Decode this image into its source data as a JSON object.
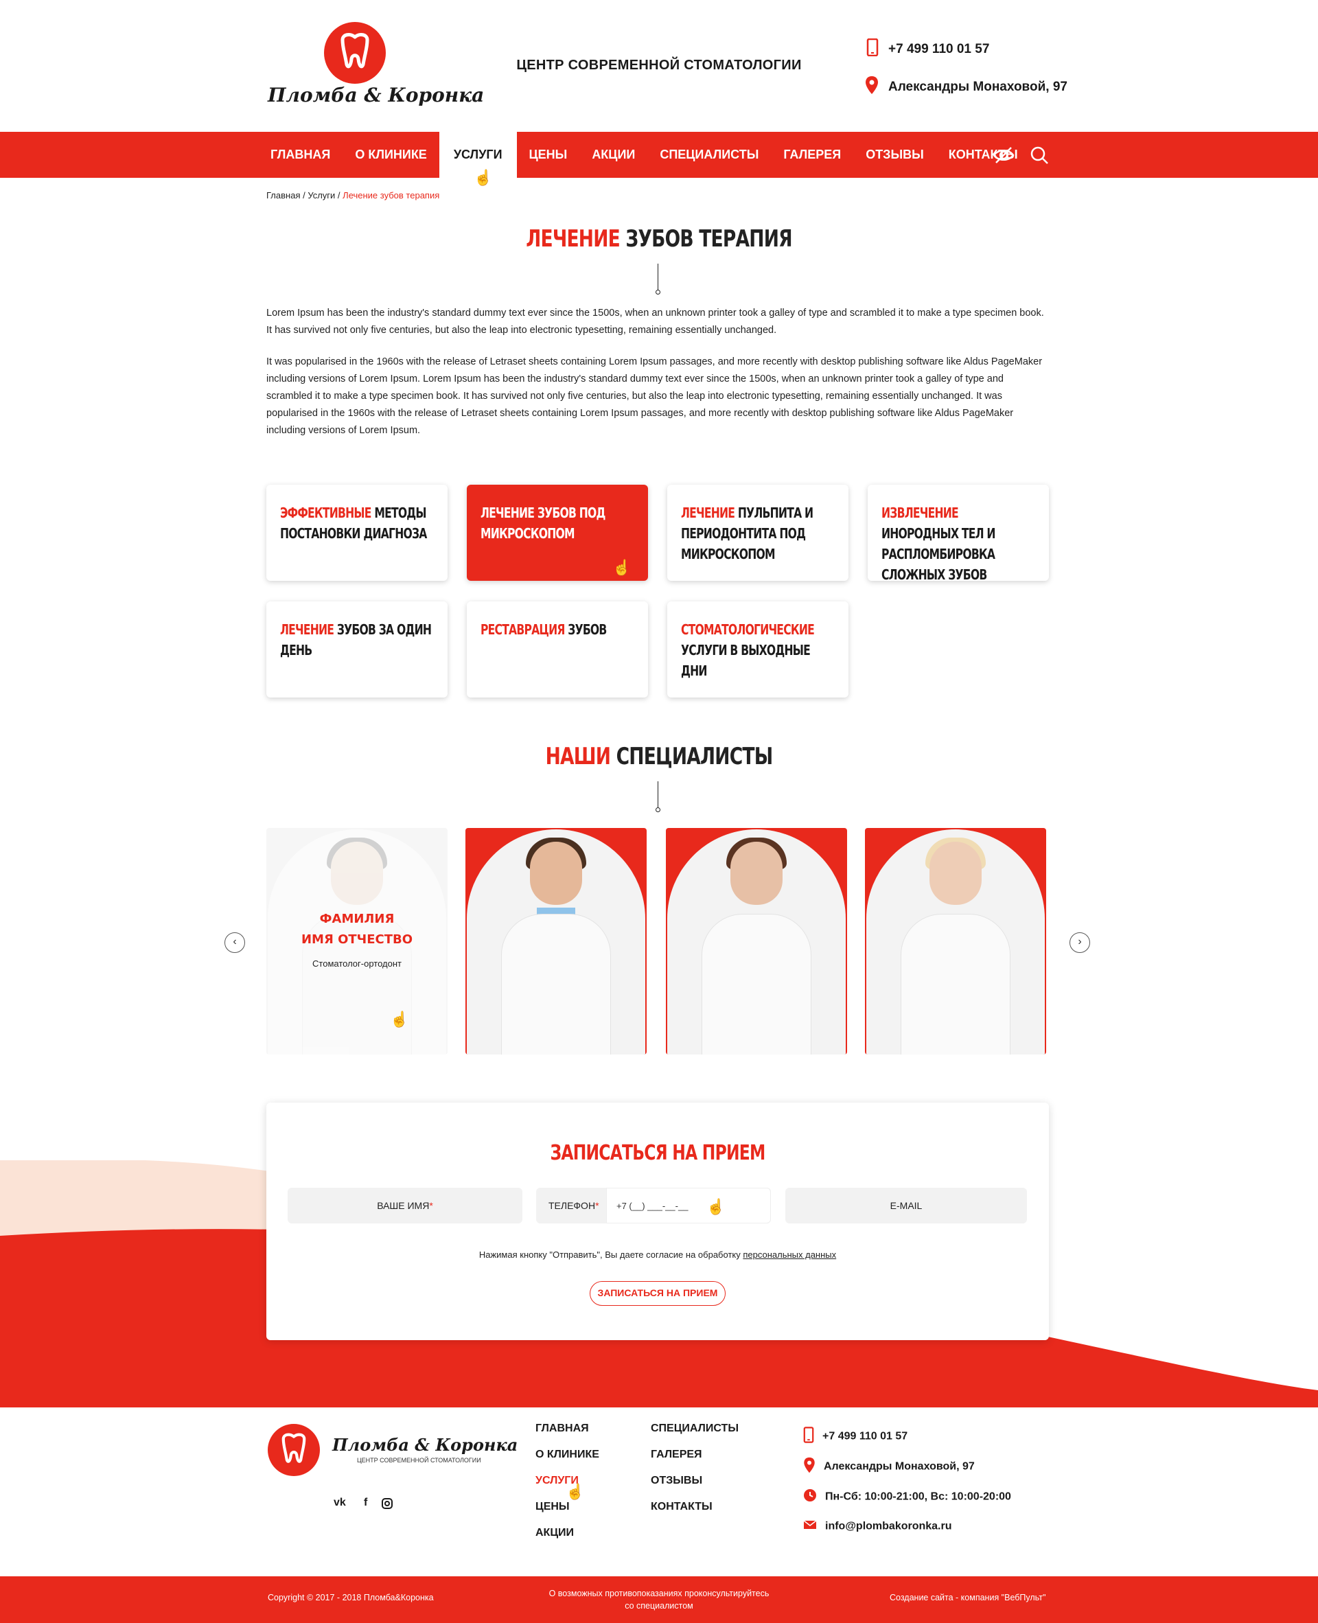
{
  "header": {
    "logo_text": "Пломба & Коронка",
    "tagline": "ЦЕНТР СОВРЕМЕННОЙ СТОМАТОЛОГИИ",
    "phone": "+7 499 110 01 57",
    "address": "Александры Монаховой, 97"
  },
  "nav": {
    "items": [
      "ГЛАВНАЯ",
      "О КЛИНИКЕ",
      "УСЛУГИ",
      "ЦЕНЫ",
      "АКЦИИ",
      "СПЕЦИАЛИСТЫ",
      "ГАЛЕРЕЯ",
      "ОТЗЫВЫ",
      "КОНТАКТЫ"
    ],
    "active": "УСЛУГИ",
    "icons": [
      "eye-accessibility-icon",
      "search-icon"
    ]
  },
  "breadcrumb": {
    "home": "Главная",
    "sep": " / ",
    "section": "Услуги",
    "current": "Лечение зубов терапия"
  },
  "page": {
    "title_highlight": "ЛЕЧЕНИЕ",
    "title_rest": " ЗУБОВ ТЕРАПИЯ",
    "paragraph1": "Lorem Ipsum has been the industry's standard dummy text ever since the 1500s, when an unknown printer took a galley of type and scrambled it to make a type specimen book. It has survived not only five centuries, but also the leap into electronic typesetting, remaining essentially unchanged.",
    "paragraph2": "It was popularised in the 1960s with the release of Letraset sheets containing Lorem Ipsum passages, and more recently with desktop publishing software like Aldus PageMaker including versions of Lorem Ipsum. Lorem Ipsum has been the industry's standard dummy text ever since the 1500s, when an unknown printer took a galley of type and scrambled it to make a type specimen book. It has survived not only five centuries, but also the leap into electronic typesetting, remaining essentially unchanged. It was popularised in the 1960s with the release of Letraset sheets containing Lorem Ipsum passages, and more recently with desktop publishing software like Aldus PageMaker including versions of Lorem Ipsum."
  },
  "services": [
    {
      "hl": "ЭФФЕКТИВНЫЕ",
      "rest": " МЕТОДЫ ПОСТАНОВКИ ДИАГНОЗА",
      "active": false
    },
    {
      "hl": "ЛЕЧЕНИЕ",
      "rest": " ЗУБОВ ПОД МИКРОСКОПОМ",
      "active": true
    },
    {
      "hl": "ЛЕЧЕНИЕ",
      "rest": " ПУЛЬПИТА И ПЕРИОДОНТИТА ПОД МИКРОСКОПОМ",
      "active": false
    },
    {
      "hl": "ИЗВЛЕЧЕНИЕ",
      "rest": " ИНОРОДНЫХ ТЕЛ И РАСПЛОМБИРОВКА СЛОЖНЫХ ЗУБОВ",
      "active": false
    },
    {
      "hl": "ЛЕЧЕНИЕ",
      "rest": " ЗУБОВ ЗА ОДИН ДЕНЬ",
      "active": false
    },
    {
      "hl": "РЕСТАВРАЦИЯ",
      "rest": " ЗУБОВ",
      "active": false
    },
    {
      "hl": "СТОМАТОЛОГИЧЕСКИЕ",
      "rest": " УСЛУГИ В ВЫХОДНЫЕ ДНИ",
      "active": false
    }
  ],
  "specialists": {
    "title_highlight": "НАШИ",
    "title_rest": " СПЕЦИАЛИСТЫ",
    "hover_card": {
      "surname": "ФАМИЛИЯ",
      "name": "ИМЯ ОТЧЕСТВО",
      "role": "Стоматолог-ортодонт"
    },
    "prev": "‹",
    "next": "›"
  },
  "booking": {
    "title": "ЗАПИСАТЬСЯ НА ПРИЕМ",
    "name_label": "ВАШЕ ИМЯ",
    "phone_label": "ТЕЛЕФОН",
    "phone_mask": "+7 (__) ___-__-__",
    "email_label": "E-MAIL",
    "required": "*",
    "consent_text": "Нажимая кнопку \"Отправить\", Вы даете согласие на обработку ",
    "consent_link": "персональных данных",
    "submit": "ЗАПИСАТЬСЯ НА ПРИЕМ"
  },
  "footer": {
    "logo_text": "Пломба & Коронка",
    "tagline": "ЦЕНТР СОВРЕМЕННОЙ СТОМАТОЛОГИИ",
    "social": [
      "vk",
      "f",
      "instagram"
    ],
    "menu_col1": [
      "ГЛАВНАЯ",
      "О КЛИНИКЕ",
      "УСЛУГИ",
      "ЦЕНЫ",
      "АКЦИИ"
    ],
    "menu_col2": [
      "СПЕЦИАЛИСТЫ",
      "ГАЛЕРЕЯ",
      "ОТЗЫВЫ",
      "КОНТАКТЫ"
    ],
    "phone": "+7 499 110 01 57",
    "address": "Александры Монаховой, 97",
    "hours": "Пн-Сб: 10:00-21:00, Вс: 10:00-20:00",
    "email": "info@plombakoronka.ru",
    "copyright": "Copyright © 2017 - 2018 Пломба&Коронка",
    "disclaimer1": "О возможных противопоказаниях проконсультируйтесь",
    "disclaimer2": "со специалистом",
    "credits": "Создание сайта - компания \"ВебПульт\""
  },
  "colors": {
    "accent": "#e8291c",
    "peach": "#fbe3d6"
  }
}
